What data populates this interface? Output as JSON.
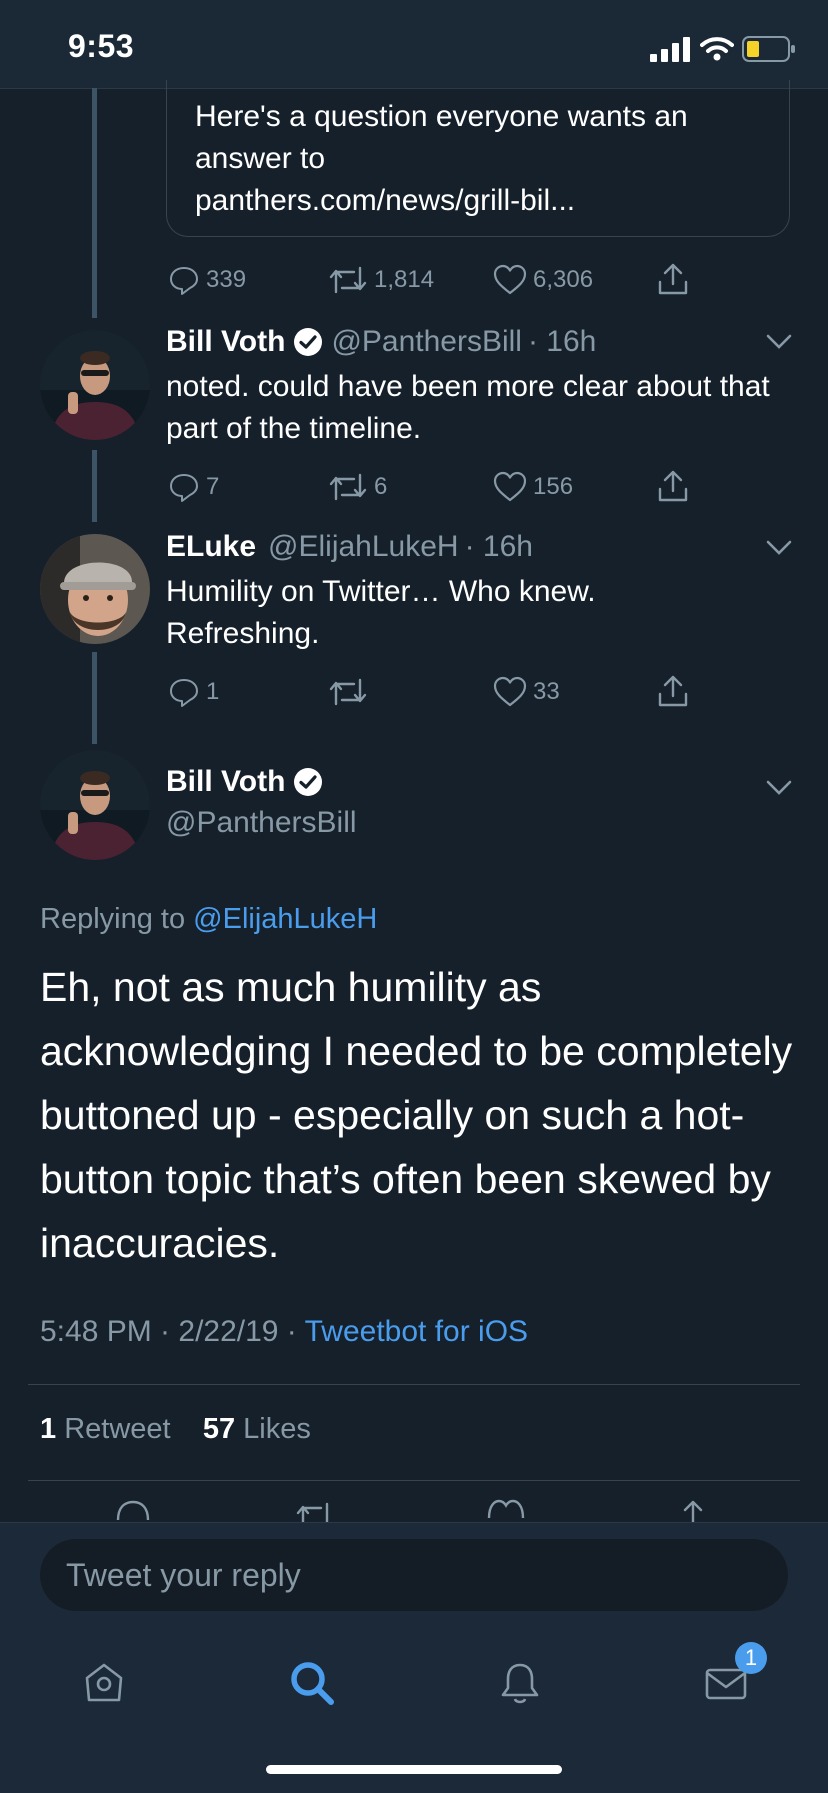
{
  "status_bar": {
    "time": "9:53"
  },
  "quoted_tweet": {
    "text": "Here's a question everyone wants an answer to",
    "link": "panthers.com/news/grill-bil...",
    "replies": "339",
    "retweets": "1,814",
    "likes": "6,306"
  },
  "tweets": [
    {
      "name": "Bill Voth",
      "handle": "@PanthersBill",
      "time": "· 16h",
      "text": "noted. could have been more clear about that part of the timeline.",
      "replies": "7",
      "retweets": "6",
      "likes": "156"
    },
    {
      "name": "ELuke",
      "handle": "@ElijahLukeH",
      "time": "· 16h",
      "text": "Humility on Twitter… Who knew. Refreshing.",
      "replies": "1",
      "retweets": "",
      "likes": "33"
    }
  ],
  "main_tweet": {
    "name": "Bill Voth",
    "handle": "@PanthersBill",
    "replying_prefix": "Replying to",
    "replying_to": "@ElijahLukeH",
    "text": "Eh, not as much humility as acknowledging I needed to be completely buttoned up - especially on such a hot-button topic that’s often been skewed by inaccuracies.",
    "timestamp": "5:48 PM · 2/22/19 ·",
    "client": "Tweetbot for iOS",
    "retweet_count": "1",
    "retweet_label": "Retweet",
    "like_count": "57",
    "like_label": "Likes"
  },
  "reply_bar": {
    "placeholder": "Tweet your reply"
  },
  "tab_bar": {
    "items": [
      "home-icon",
      "search-icon",
      "notifications-icon",
      "messages-icon"
    ],
    "active": "search-icon",
    "messages_badge": "1"
  },
  "colors": {
    "background": "#15202b",
    "accent": "#4a9ded",
    "muted": "#8899a6"
  }
}
